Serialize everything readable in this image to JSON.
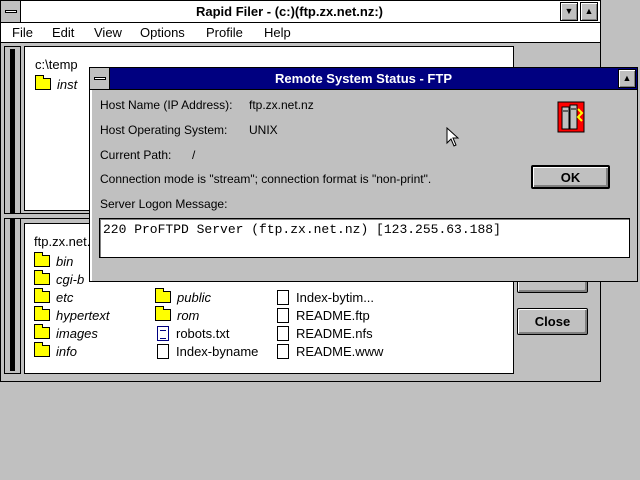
{
  "main_window": {
    "title": "Rapid Filer - (c:)(ftp.zx.net.nz:)",
    "menu": [
      "File",
      "Edit",
      "View",
      "Options",
      "Profile",
      "Help"
    ]
  },
  "local_pane": {
    "path": "c:\\temp",
    "items": [
      "inst"
    ]
  },
  "remote_pane": {
    "path": "ftp.zx.net.nz:",
    "col1": [
      "bin",
      "cgi-b",
      "etc",
      "hypertext",
      "images",
      "info"
    ],
    "col2": [
      "public",
      "rom",
      "robots.txt",
      "Index-byname"
    ],
    "col3": [
      "Index-bytim...",
      "README.ftp",
      "README.nfs",
      "README.www"
    ]
  },
  "buttons": {
    "close": "Close"
  },
  "dialog": {
    "title": "Remote System Status - FTP",
    "host_name_label": "Host Name (IP Address):",
    "host_name_value": "ftp.zx.net.nz",
    "host_os_label": "Host Operating System:",
    "host_os_value": "UNIX",
    "path_label": "Current Path:",
    "path_value": "/",
    "connection_mode": "Connection mode is \"stream\"; connection format is \"non-print\".",
    "logon_label": "Server Logon Message:",
    "logon_message": "220 ProFTPD Server (ftp.zx.net.nz) [123.255.63.188]",
    "ok_label": "OK"
  }
}
